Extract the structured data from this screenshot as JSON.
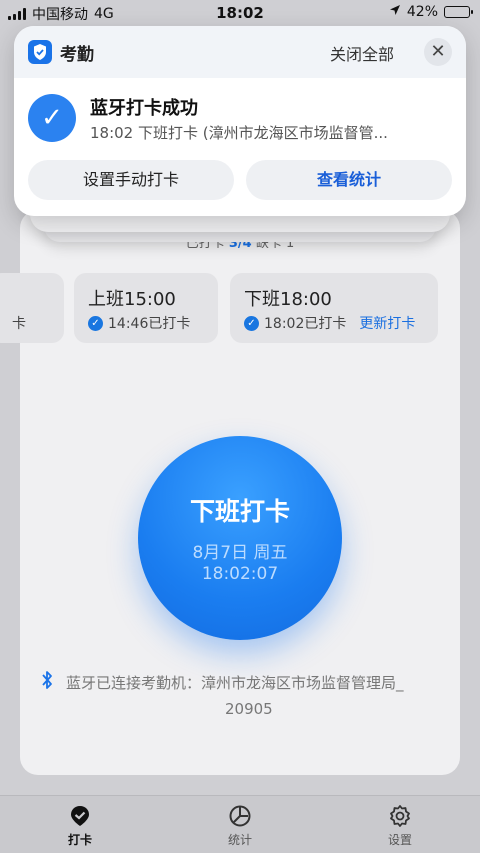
{
  "status_bar": {
    "carrier": "中国移动",
    "network": "4G",
    "time": "18:02",
    "battery": "42%",
    "battery_level": 0.42
  },
  "notification": {
    "app_name": "考勤",
    "close_all": "关闭全部",
    "title": "蓝牙打卡成功",
    "subtitle": "18:02 下班打卡 (漳州市龙海区市场监督管...",
    "action_left": "设置手动打卡",
    "action_right": "查看统计"
  },
  "main": {
    "progress_prefix": "已打卡",
    "progress_count": "3/4",
    "progress_suffix": "缺卡 1",
    "shifts": [
      {
        "title": "",
        "status": "卡"
      },
      {
        "title": "上班15:00",
        "status": "14:46已打卡"
      },
      {
        "title": "下班18:00",
        "status": "18:02已打卡",
        "link": "更新打卡"
      }
    ],
    "clock_button": {
      "label": "下班打卡",
      "date": "8月7日 周五",
      "time": "18:02:07"
    },
    "bluetooth_text": "蓝牙已连接考勤机：漳州市龙海区市场监督管理局_",
    "bluetooth_text2": "20905"
  },
  "tab_bar": {
    "items": [
      {
        "label": "打卡",
        "icon": "checkin-icon",
        "active": true
      },
      {
        "label": "统计",
        "icon": "stats-icon",
        "active": false
      },
      {
        "label": "设置",
        "icon": "gear-icon",
        "active": false
      }
    ]
  },
  "colors": {
    "accent": "#1a73e8",
    "button_blue": "#1a7df0"
  }
}
